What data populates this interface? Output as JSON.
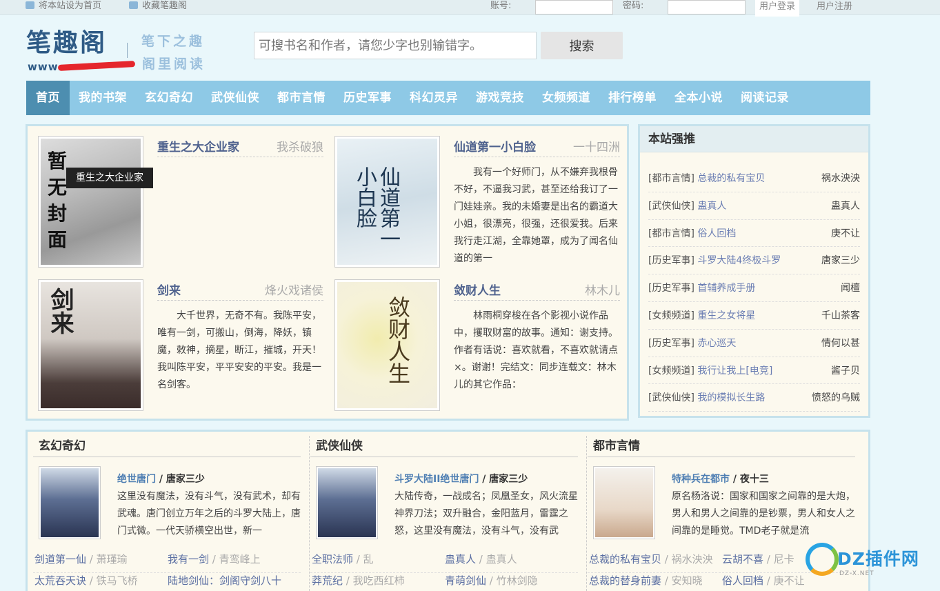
{
  "topbar": {
    "set_home": "将本站设为首页",
    "bookmark": "收藏笔趣阁",
    "account_label": "账号:",
    "password_label": "密码:",
    "login_button": "用户登录",
    "register_link": "用户注册",
    "icons": [
      "home-icon",
      "bookmark-icon"
    ]
  },
  "logo": {
    "name": "笔趣阁",
    "url_prefix": "www.",
    "slogan_line1": "笔下之趣",
    "slogan_line2": "阁里阅读",
    "colors": {
      "brand": "#2f5b86",
      "slogan": "#9cc0dd"
    }
  },
  "search": {
    "placeholder": "可搜书名和作者，请您少字也别输错字。",
    "button": "搜索"
  },
  "nav": {
    "items": [
      "首页",
      "我的书架",
      "玄幻奇幻",
      "武侠仙侠",
      "都市言情",
      "历史军事",
      "科幻灵异",
      "游戏竞技",
      "女频频道",
      "排行榜单",
      "全本小说",
      "阅读记录"
    ],
    "active": "首页",
    "colors": {
      "bar": "#8ec9e6",
      "active": "#4d8eb0"
    }
  },
  "hot": {
    "items": [
      {
        "title": "重生之大企业家",
        "author": "我杀破狼",
        "desc": "",
        "cover_text": [
          "暂",
          "无",
          "封",
          "面"
        ]
      },
      {
        "title": "仙道第一小白脸",
        "author": "一十四洲",
        "desc": "我有一个好师门，从不嫌弃我根骨不好，不逼我习武，甚至还给我订了一门娃娃亲。我的未婚妻是出名的霸道大小姐，很漂亮，很强，还很爱我。后来我行走江湖，全靠她罩，成为了闻名仙道的第一",
        "cover_text": "仙道第一小白脸"
      },
      {
        "title": "剑来",
        "author": "烽火戏诸侯",
        "desc": "大千世界，无奇不有。我陈平安，唯有一剑，可搬山，倒海，降妖，镇魔，敕神，摘星，断江，摧城，开天！我叫陈平安，平平安安的平安。我是一名剑客。",
        "cover_text": "剑来"
      },
      {
        "title": "敛财人生",
        "author": "林木儿",
        "desc": "林雨桐穿梭在各个影视小说作品中，攫取财富的故事。通知：谢支持。作者有话说：喜欢就看，不喜欢就请点×。谢谢！完结文：同步连载文：林木儿的其它作品：",
        "cover_text": "敛财人生"
      }
    ],
    "tooltip": "重生之大企业家"
  },
  "recommend": {
    "title": "本站强推",
    "items": [
      {
        "category": "[都市言情]",
        "name": "总裁的私有宝贝",
        "author": "祸水泱泱"
      },
      {
        "category": "[武侠仙侠]",
        "name": "蛊真人",
        "author": "蛊真人"
      },
      {
        "category": "[都市言情]",
        "name": "俗人回档",
        "author": "庚不让"
      },
      {
        "category": "[历史军事]",
        "name": "斗罗大陆4终极斗罗",
        "author": "唐家三少"
      },
      {
        "category": "[历史军事]",
        "name": "首辅养成手册",
        "author": "闻檀"
      },
      {
        "category": "[女频频道]",
        "name": "重生之女将星",
        "author": "千山茶客"
      },
      {
        "category": "[历史军事]",
        "name": "赤心巡天",
        "author": "情何以甚"
      },
      {
        "category": "[女频频道]",
        "name": "我行让我上[电竞]",
        "author": "酱子贝"
      },
      {
        "category": "[武侠仙侠]",
        "name": "我的模拟长生路",
        "author": "愤怒的乌贼"
      }
    ]
  },
  "categories": [
    {
      "title": "玄幻奇幻",
      "featured": {
        "name": "绝世唐门",
        "author": "唐家三少",
        "desc": "这里没有魔法，没有斗气，没有武术，却有武魂。唐门创立万年之后的斗罗大陆上，唐门式微。一代天骄横空出世，新一"
      },
      "links": [
        [
          {
            "name": "剑道第一仙",
            "author": "萧瑾瑜"
          },
          {
            "name": "我有一剑",
            "author": "青鸾峰上"
          }
        ],
        [
          {
            "name": "太荒吞天诀",
            "author": "铁马飞桥"
          },
          {
            "name": "陆地剑仙：剑阁守剑八十",
            "author": ""
          }
        ]
      ]
    },
    {
      "title": "武侠仙侠",
      "featured": {
        "name": "斗罗大陆II绝世唐门",
        "author": "唐家三少",
        "desc": "大陆传奇，一战成名；凤凰圣女，风火流星神界刀法；双升融合，金阳蓝月，雷霆之怒，这里没有魔法，没有斗气，没有武"
      },
      "links": [
        [
          {
            "name": "全职法师",
            "author": "乱"
          },
          {
            "name": "蛊真人",
            "author": "蛊真人"
          }
        ],
        [
          {
            "name": "莽荒纪",
            "author": "我吃西红柿"
          },
          {
            "name": "青萌剑仙",
            "author": "竹林剑隐"
          }
        ]
      ]
    },
    {
      "title": "都市言情",
      "featured": {
        "name": "特种兵在都市",
        "author": "夜十三",
        "desc": "原名杨洛说：国家和国家之间靠的是大炮，男人和男人之间靠的是钞票，男人和女人之间靠的是睡觉。TMD老子就是流"
      },
      "links": [
        [
          {
            "name": "总裁的私有宝贝",
            "author": "祸水泱泱"
          },
          {
            "name": "云胡不喜",
            "author": "尼卡"
          }
        ],
        [
          {
            "name": "总裁的替身前妻",
            "author": "安知晓"
          },
          {
            "name": "俗人回档",
            "author": "庚不让"
          }
        ]
      ]
    }
  ],
  "watermark": {
    "text": "DZ插件网",
    "sub": "DZ-X.NET"
  }
}
